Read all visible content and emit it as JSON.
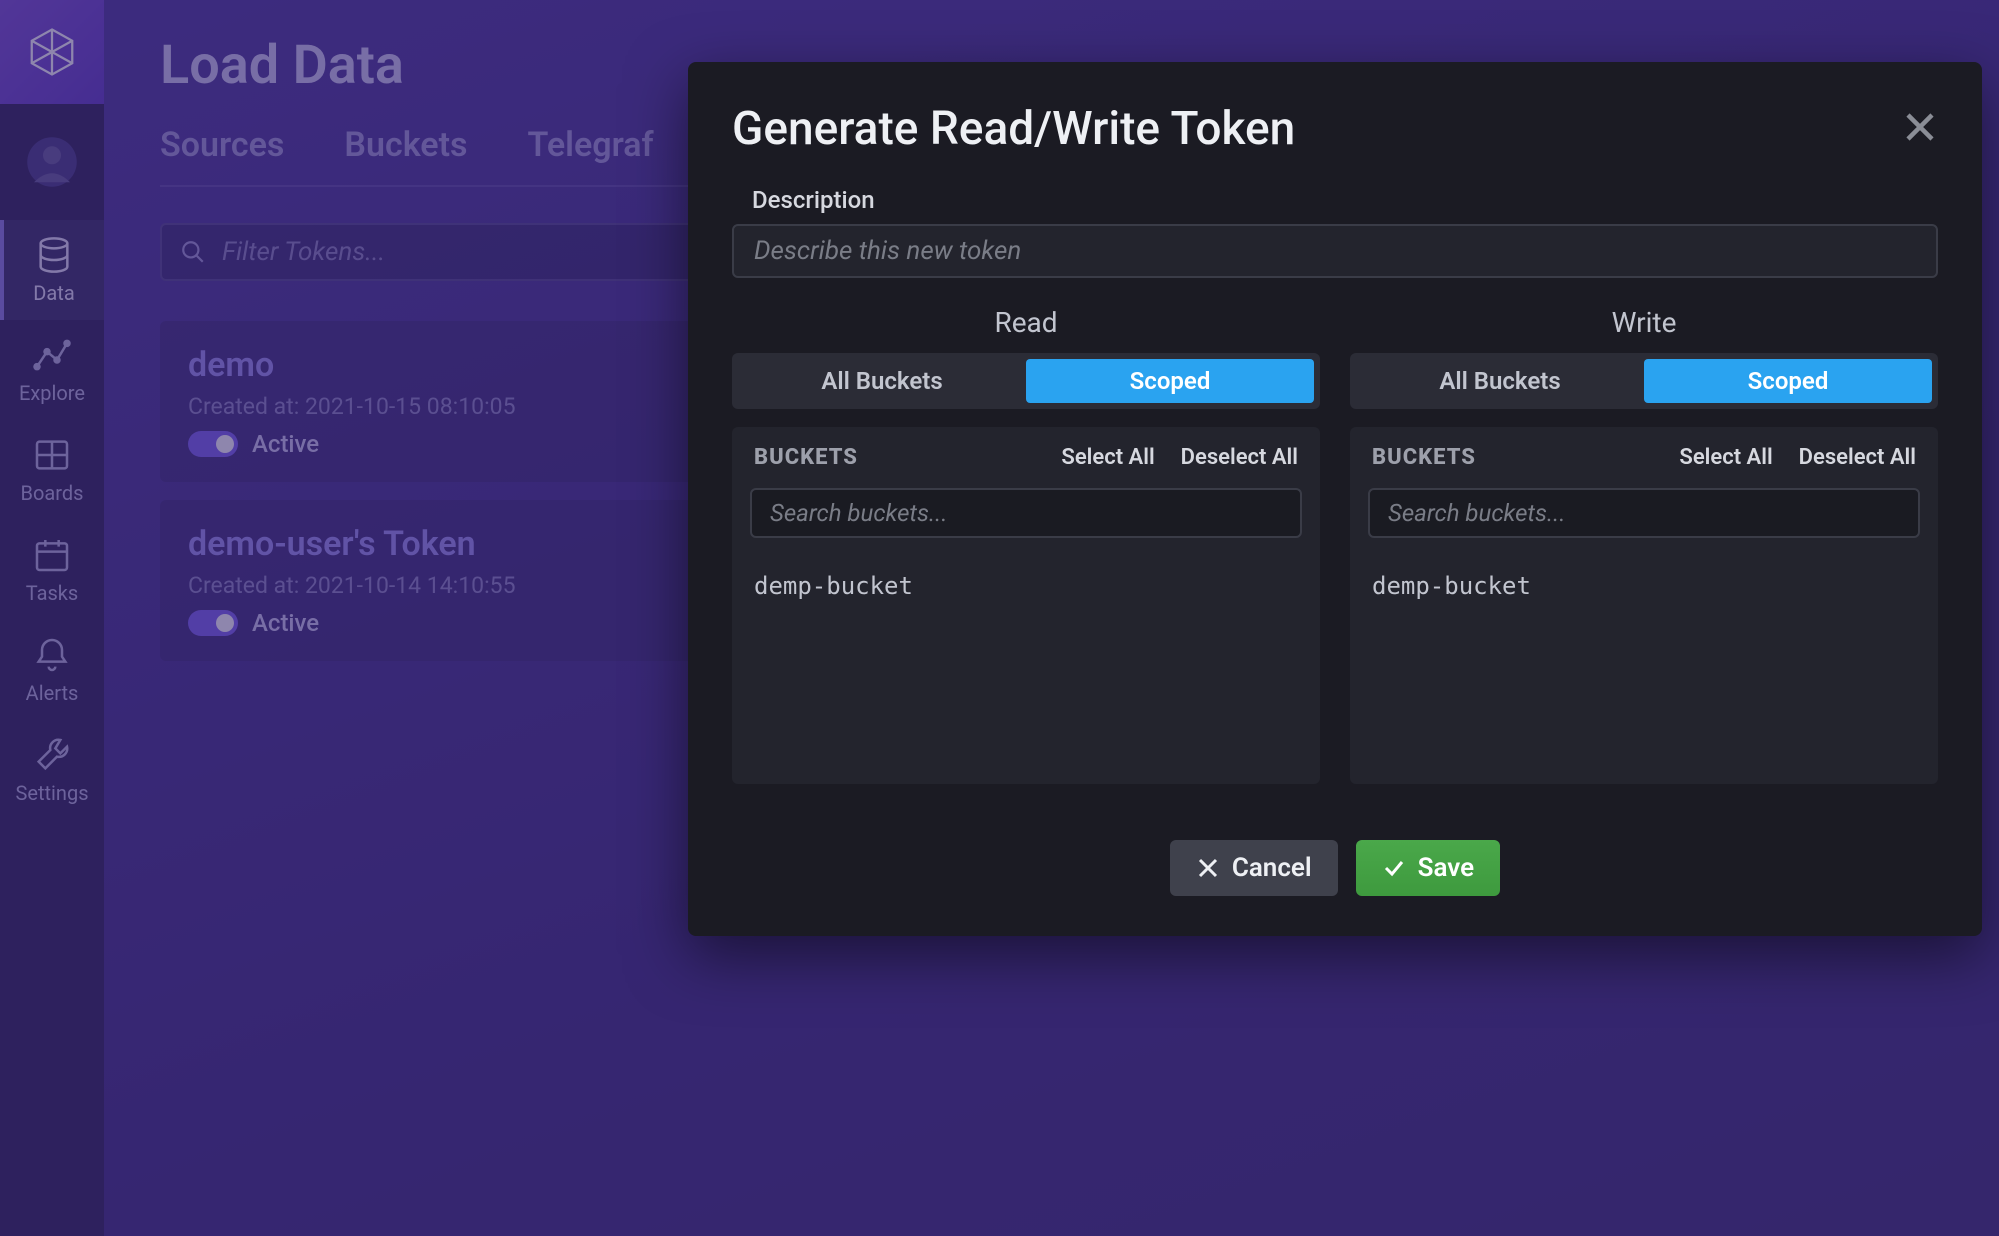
{
  "page": {
    "title": "Load Data"
  },
  "sidebar": {
    "items": [
      {
        "label": "Data"
      },
      {
        "label": "Explore"
      },
      {
        "label": "Boards"
      },
      {
        "label": "Tasks"
      },
      {
        "label": "Alerts"
      },
      {
        "label": "Settings"
      }
    ]
  },
  "tabs": [
    {
      "label": "Sources"
    },
    {
      "label": "Buckets"
    },
    {
      "label": "Telegraf"
    }
  ],
  "filter": {
    "placeholder": "Filter Tokens..."
  },
  "tokens": [
    {
      "name": "demo",
      "created": "Created at: 2021-10-15 08:10:05",
      "status": "Active"
    },
    {
      "name": "demo-user's Token",
      "created": "Created at: 2021-10-14 14:10:55",
      "status": "Active"
    }
  ],
  "modal": {
    "title": "Generate Read/Write Token",
    "description_label": "Description",
    "description_placeholder": "Describe this new token",
    "read_heading": "Read",
    "write_heading": "Write",
    "scope_all": "All Buckets",
    "scope_scoped": "Scoped",
    "buckets_title": "BUCKETS",
    "select_all": "Select All",
    "deselect_all": "Deselect All",
    "search_placeholder": "Search buckets...",
    "read_buckets": [
      "demp-bucket"
    ],
    "write_buckets": [
      "demp-bucket"
    ],
    "cancel": "Cancel",
    "save": "Save"
  }
}
